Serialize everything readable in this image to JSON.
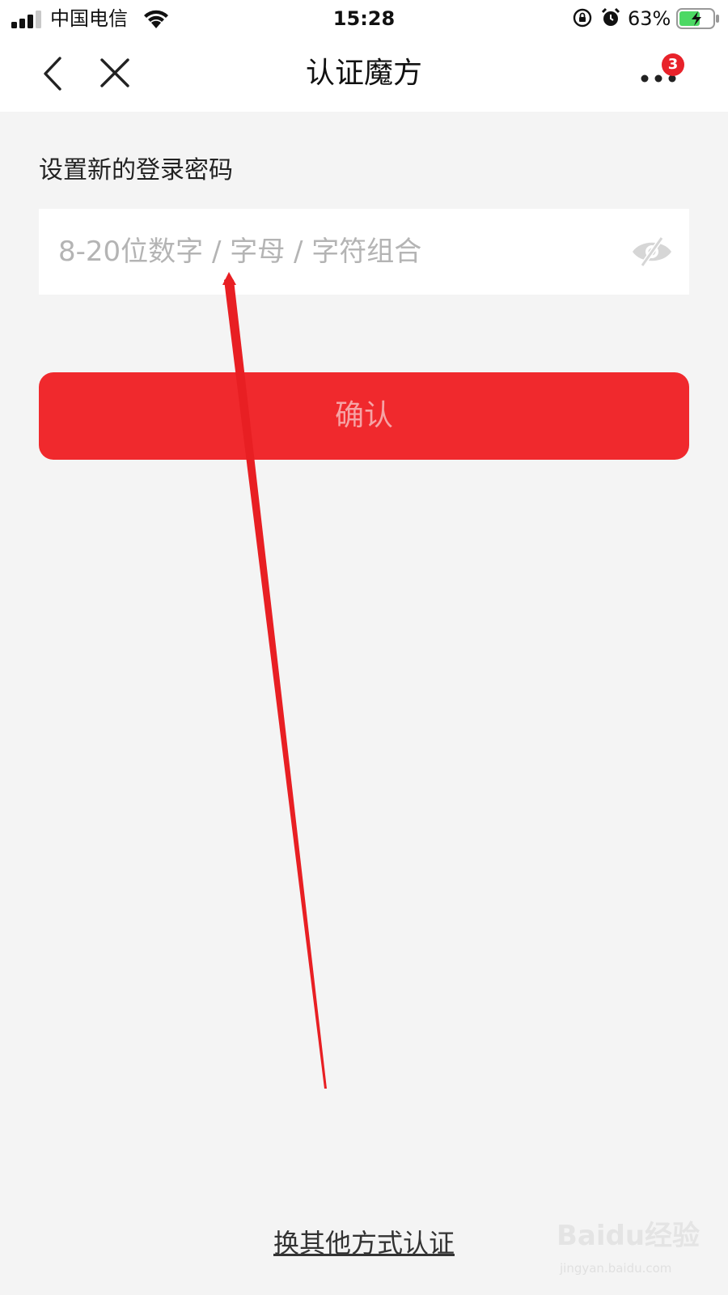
{
  "status_bar": {
    "carrier": "中国电信",
    "time": "15:28",
    "battery_percent": "63%",
    "signal_bars": 3,
    "signal_bars_total": 4,
    "battery_level": 0.63,
    "icons": [
      "signal-icon",
      "wifi-icon",
      "orientation-lock-icon",
      "alarm-icon",
      "battery-charging-icon"
    ]
  },
  "nav": {
    "title": "认证魔方",
    "back_icon": "chevron-left-icon",
    "close_icon": "close-icon",
    "more_icon": "more-dots-icon",
    "badge_count": "3"
  },
  "form": {
    "label": "设置新的登录密码",
    "password_placeholder": "8-20位数字 / 字母 / 字符组合",
    "password_value": "",
    "eye_icon": "eye-hidden-icon",
    "confirm_label": "确认"
  },
  "footer": {
    "switch_method_label": "换其他方式认证"
  },
  "watermark": {
    "brand": "Baidu经验",
    "url": "jingyan.baidu.com"
  },
  "colors": {
    "accent": "#f0292d",
    "background": "#f4f4f4",
    "placeholder": "#b4b4b4",
    "badge": "#e8222a"
  }
}
